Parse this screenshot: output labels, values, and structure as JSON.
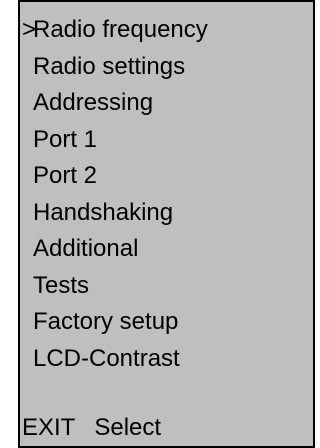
{
  "display": {
    "background_color": "#bfbfbf",
    "text_color": "#000000",
    "border_color": "#000000"
  },
  "menu": {
    "cursor_symbol": ">",
    "selected_index": 0,
    "items": [
      {
        "label": "Radio frequency"
      },
      {
        "label": "Radio settings"
      },
      {
        "label": "Addressing"
      },
      {
        "label": "Port 1"
      },
      {
        "label": "Port 2"
      },
      {
        "label": "Handshaking"
      },
      {
        "label": "Additional"
      },
      {
        "label": "Tests"
      },
      {
        "label": "Factory setup"
      },
      {
        "label": "LCD-Contrast"
      }
    ]
  },
  "softkeys": {
    "left_label": "EXIT",
    "right_label": "Select"
  }
}
